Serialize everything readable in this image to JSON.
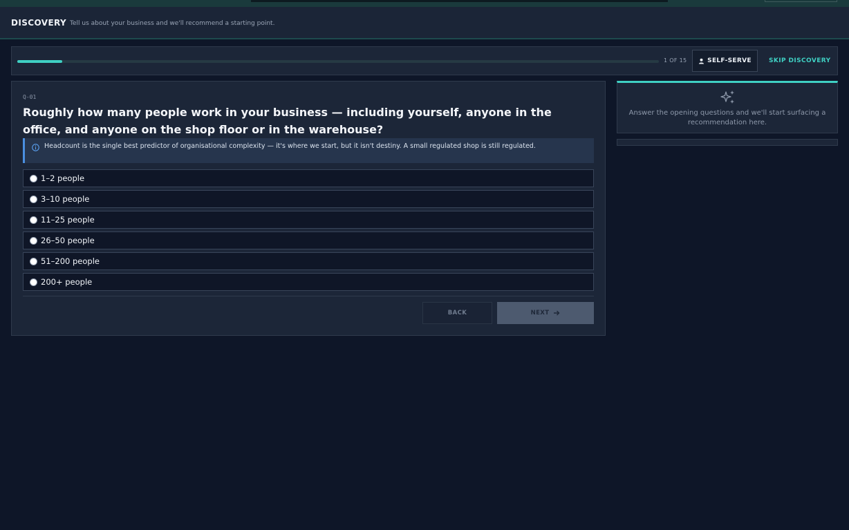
{
  "header": {
    "title": "DISCOVERY",
    "subtitle": "Tell us about your business and we'll recommend a starting point."
  },
  "progress": {
    "current": 1,
    "total": 15,
    "fraction": 0.07,
    "label": "1 OF 15",
    "self_serve_label": "SELF-SERVE",
    "skip_label": "SKIP DISCOVERY"
  },
  "question": {
    "id": "Q-01",
    "text": "Roughly how many people work in your business — including yourself, anyone in the office, and anyone on the shop floor or in the warehouse?",
    "hint": "Headcount is the single best predictor of organisational complexity — it's where we start, but it isn't destiny. A small regulated shop is still regulated.",
    "options": [
      {
        "label": "1–2 people"
      },
      {
        "label": "3–10 people"
      },
      {
        "label": "11–25 people"
      },
      {
        "label": "26–50 people"
      },
      {
        "label": "51–200 people"
      },
      {
        "label": "200+ people"
      }
    ]
  },
  "nav": {
    "back_label": "BACK",
    "next_label": "NEXT"
  },
  "recommendation": {
    "placeholder": "Answer the opening questions and we'll start surfacing a recommendation here."
  },
  "colors": {
    "accent": "#3fd0c3",
    "info": "#4a8fe0",
    "background": "#0e1628",
    "card": "#1c2638"
  },
  "icons": [
    "person-icon",
    "info-icon",
    "sparkle-icon",
    "arrow-right-icon",
    "radio-icon"
  ]
}
